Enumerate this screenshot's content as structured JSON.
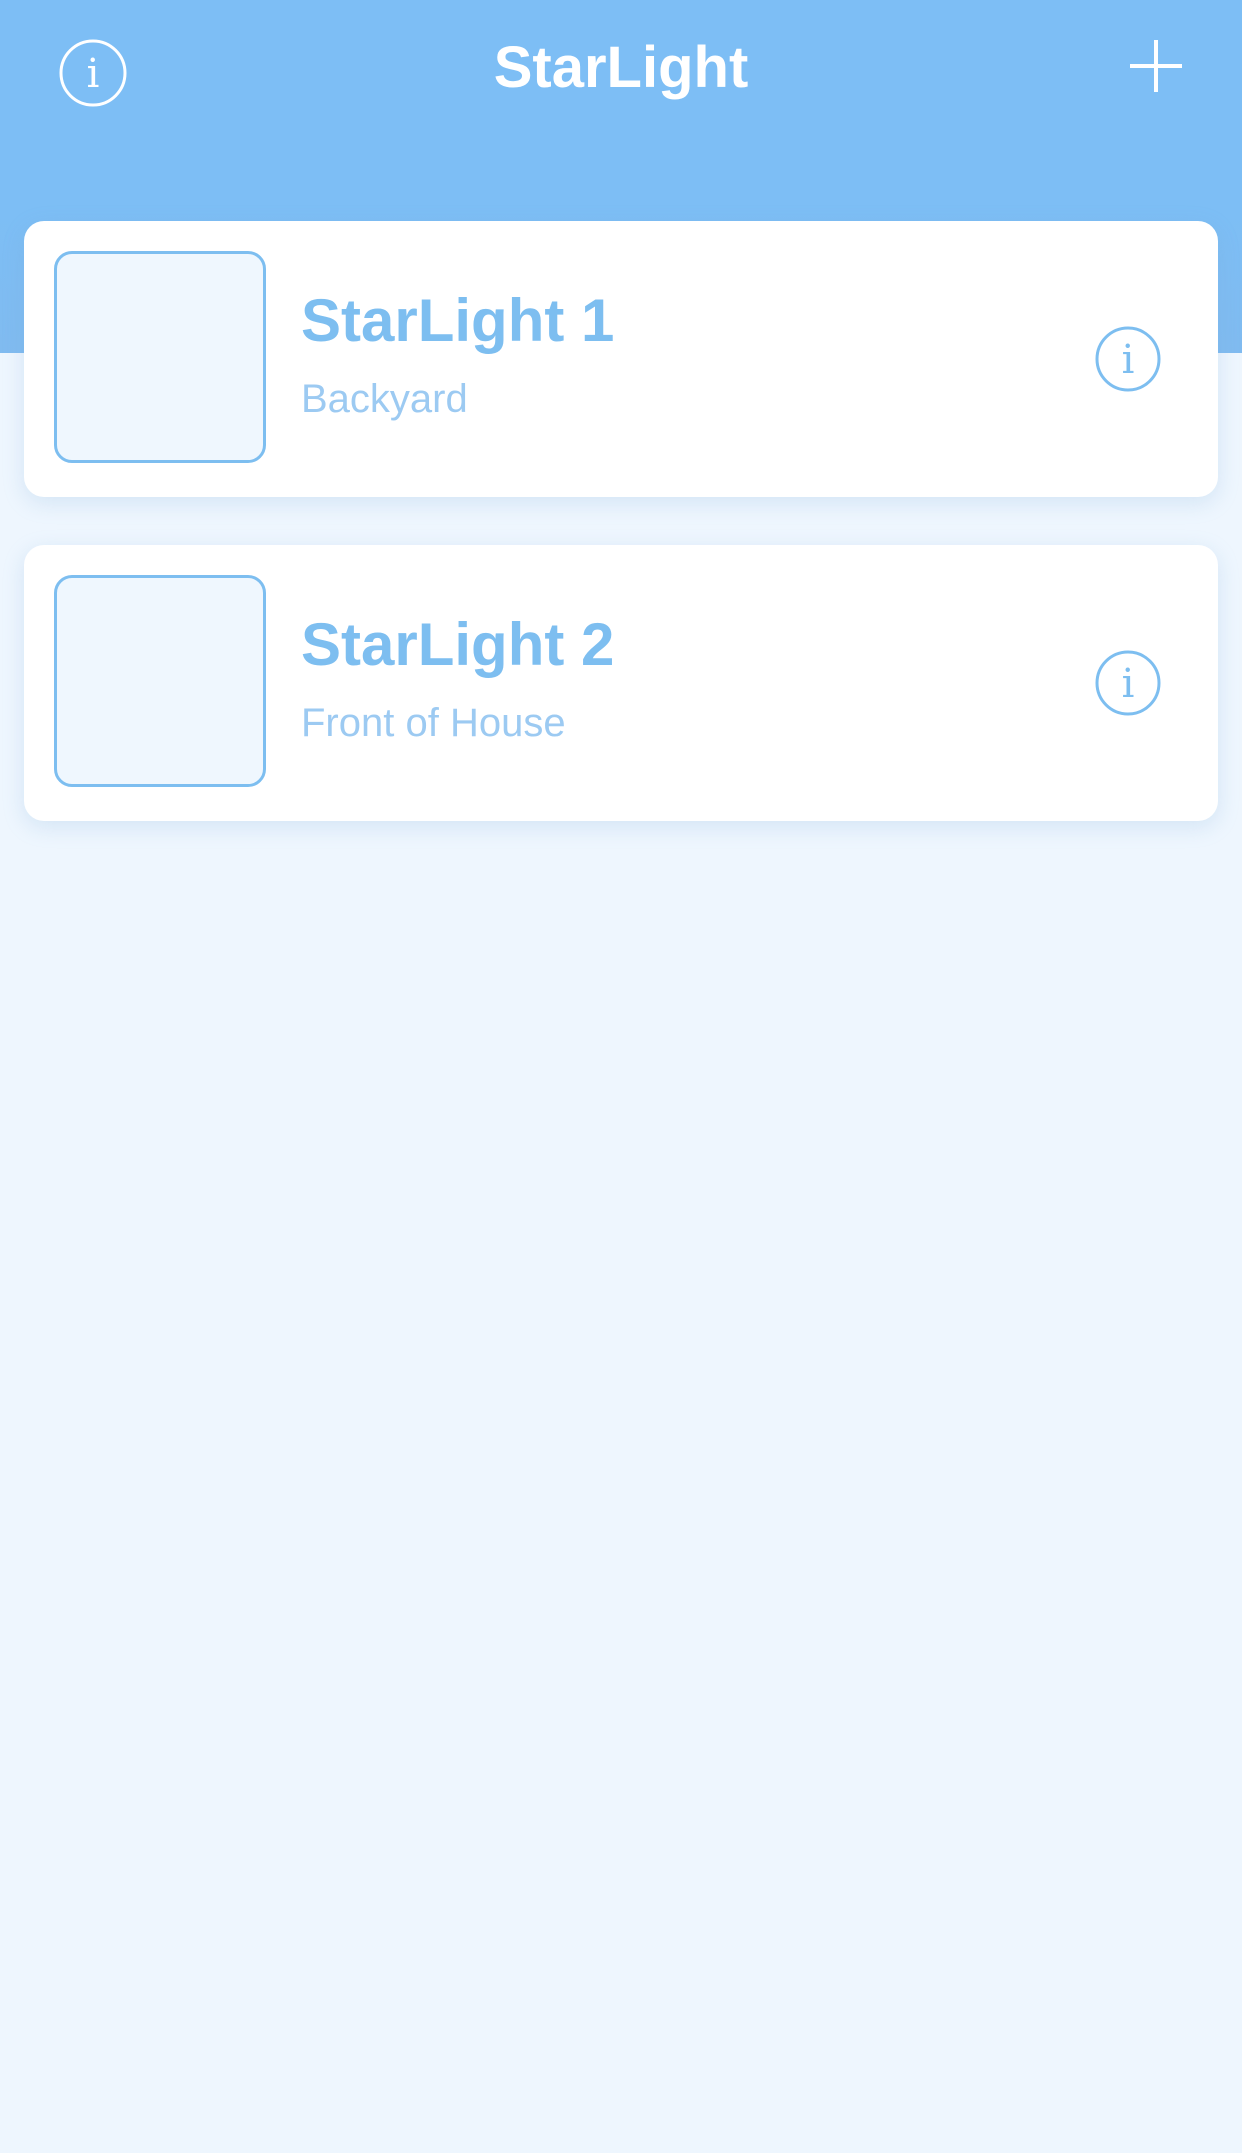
{
  "header": {
    "title": "StarLight",
    "left_icon": "info-icon",
    "right_icon": "plus-icon"
  },
  "colors": {
    "header_background": "#7dbef5",
    "page_background": "#eef6fe",
    "accent": "#7dbef0",
    "subtitle": "#9ccaf2",
    "card_background": "#ffffff"
  },
  "devices": [
    {
      "name": "StarLight 1",
      "location": "Backyard",
      "icon": "info-icon"
    },
    {
      "name": "StarLight 2",
      "location": "Front of House",
      "icon": "info-icon"
    }
  ]
}
